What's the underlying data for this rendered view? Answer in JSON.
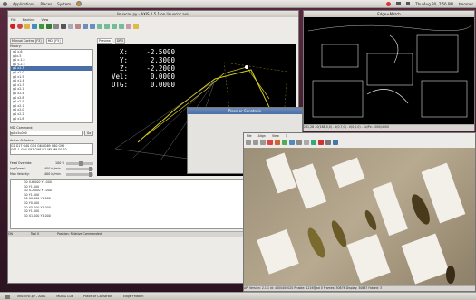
{
  "top_panel": {
    "menus": [
      "Applications",
      "Places",
      "System"
    ],
    "clock": "Thu Aug 30, 7:56 PM",
    "user": "tmorner"
  },
  "axis_window": {
    "title": "linuxcnc.py - AXIS 2.5.1 on linuxcnc.axis",
    "menu": [
      "File",
      "Machine",
      "View"
    ],
    "tabs_left": [
      "Manual Control [F3]",
      "MDI [F5]"
    ],
    "history_label": "History:",
    "history": [
      "g0 x-6",
      "g0x-5",
      "g0 x-1.5",
      "g0 y-2.5",
      "g0 x2.3",
      "g0 x2.0",
      "g0 x1.5",
      "g0 x1.4",
      "g0 x1.3",
      "g0 x2.1",
      "g0 x2.4",
      "g0 x2.8",
      "g0 x2.5",
      "g0 x2.1",
      "g0 x2.0",
      "g0 x2.2",
      "g0 x1.8"
    ],
    "mdi_label": "MDI Command:",
    "mdi_value": "g0 x5u000",
    "mdi_go": "Go",
    "gcodes_label": "Active G-Codes:",
    "gcodes_1": "G1 G17 G40 G54 G64 G69 G80 G90",
    "gcodes_2": "G91.1 G94 G97 G98 M2 M5 M9 F0 S0",
    "feed_override": "Feed Override:",
    "feed_value": "100 %",
    "jog_speed": "Jog Speed:",
    "jog_value": "400 in/min",
    "max_velocity": "Max Velocity:",
    "max_value": "400 in/min",
    "tabs_view": [
      "Preview",
      "DRO"
    ],
    "dro": [
      {
        "k": "X:",
        "v": "-2.5000"
      },
      {
        "k": "Y:",
        "v": "2.3000"
      },
      {
        "k": "Z:",
        "v": "-2.2000"
      },
      {
        "k": "Vel:",
        "v": "0.0000"
      },
      {
        "k": "DTG:",
        "v": "0.0000"
      }
    ],
    "gcode_lines": [
      "G0 X-6.000 Y1.000",
      "G0 Y1.000",
      "G0 X-2.000 Y1.000",
      "G0 Y1.000",
      "G0 X0.000 Y1.000",
      "G0 Y0.000",
      "G0 X5.000 Y1.000",
      "G0 Y1.000",
      "G0 X1.000 Y1.000"
    ],
    "status": [
      "ON",
      "Tool 0",
      "Position: Relative Commanded"
    ]
  },
  "edges_window": {
    "title": "Edge+Match",
    "status": "281,28 - 0(188,0,0) - 1(0,7,0) - 0(0,0,0) - Sx/Px: 4000/4000"
  },
  "dialog": {
    "title": "Place or Constrain"
  },
  "camera_window": {
    "menu": [
      "File",
      "Align",
      "View",
      "?"
    ],
    "status": "API Version: 2.1.1 Id: 4000400020 Rnable: 1216@ad 0 Frames: 30876 Display: 30887 Fatced: 3"
  },
  "taskbar": {
    "items": [
      "linuxcnc.py - AXIS",
      "MDI & Cut",
      "Place or Constrain",
      "Edge+Match"
    ]
  },
  "colors": {
    "accent": "#4a6ea8",
    "dro_bg": "#000000",
    "path": "#d8d020"
  }
}
